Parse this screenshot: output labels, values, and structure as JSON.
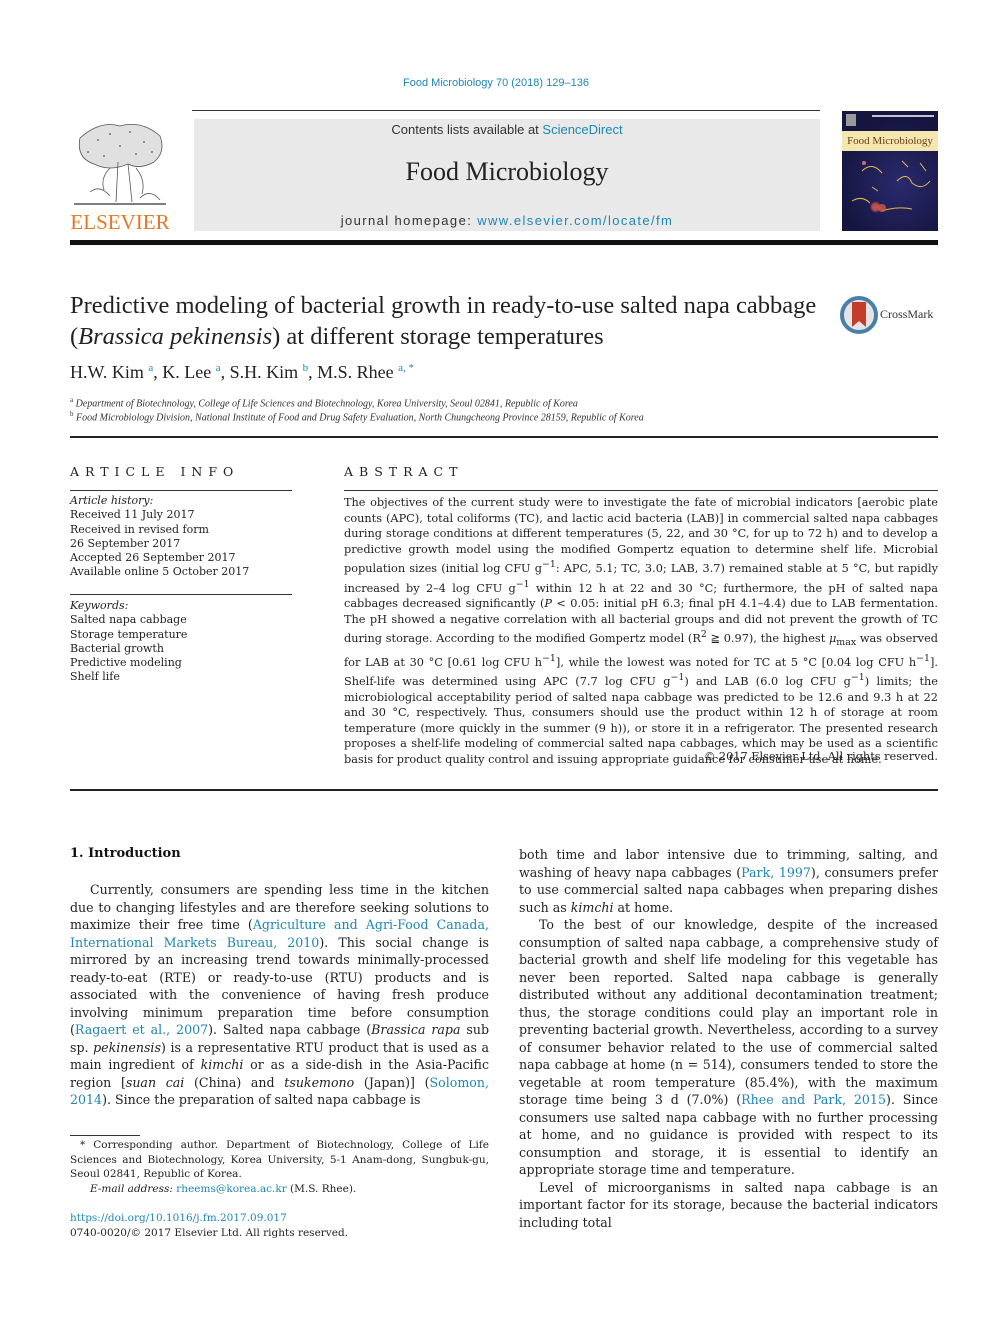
{
  "header": {
    "journal_reference": "Food Microbiology 70 (2018) 129–136",
    "contents_prefix": "Contents lists available at ",
    "contents_link": "ScienceDirect",
    "journal_title": "Food Microbiology",
    "homepage_prefix": "journal homepage: ",
    "homepage_link": "www.elsevier.com/locate/fm",
    "publisher_logo_text": "ELSEVIER",
    "cover_title": "Food Microbiology",
    "brand_color": "#e87722",
    "link_color": "#1e86b4"
  },
  "article": {
    "title_part1": "Predictive modeling of bacterial growth in ready-to-use salted napa cabbage (",
    "title_italic": "Brassica pekinensis",
    "title_part2": ") at different storage temperatures",
    "crossmark_label": "CrossMark",
    "authors": [
      {
        "name": "H.W. Kim",
        "sup": "a"
      },
      {
        "name": "K. Lee",
        "sup": "a"
      },
      {
        "name": "S.H. Kim",
        "sup": "b"
      },
      {
        "name": "M.S. Rhee",
        "sup": "a, *"
      }
    ],
    "affiliations": [
      {
        "mark": "a",
        "text": "Department of Biotechnology, College of Life Sciences and Biotechnology, Korea University, Seoul 02841, Republic of Korea"
      },
      {
        "mark": "b",
        "text": "Food Microbiology Division, National Institute of Food and Drug Safety Evaluation, North Chungcheong Province 28159, Republic of Korea"
      }
    ]
  },
  "article_info": {
    "heading": "ARTICLE INFO",
    "history_label": "Article history:",
    "history": [
      "Received 11 July 2017",
      "Received in revised form",
      "26 September 2017",
      "Accepted 26 September 2017",
      "Available online 5 October 2017"
    ],
    "keywords_label": "Keywords:",
    "keywords": [
      "Salted napa cabbage",
      "Storage temperature",
      "Bacterial growth",
      "Predictive modeling",
      "Shelf life"
    ]
  },
  "abstract": {
    "heading": "ABSTRACT",
    "segments": {
      "s1": "The objectives of the current study were to investigate the fate of microbial indicators [aerobic plate counts (APC), total coliforms (TC), and lactic acid bacteria (LAB)] in commercial salted napa cabbages during storage conditions at different temperatures (5, 22, and 30 °C, for up to 72 h) and to develop a predictive growth model using the modified Gompertz equation to determine shelf life. Microbial population sizes (initial log CFU g",
      "s2": ": APC, 5.1; TC, 3.0; LAB, 3.7) remained stable at 5 °C, but rapidly increased by 2–4 log CFU g",
      "s3": " within 12 h at 22 and 30 °C; furthermore, the pH of salted napa cabbages decreased significantly (",
      "s3_italic": "P",
      "s4": " < 0.05: initial pH 6.3; final pH 4.1–4.4) due to LAB fermentation. The pH showed a negative correlation with all bacterial groups and did not prevent the growth of TC during storage. According to the modified Gompertz model (R",
      "s4_sup": "2",
      "s5": " ≧ 0.97), the highest ",
      "mu": "μ",
      "mu_sub": "max",
      "s6": " was observed for LAB at 30 °C [0.61 log CFU h",
      "s7": "], while the lowest was noted for TC at 5 °C [0.04 log CFU h",
      "s8": "]. Shelf-life was determined using APC (7.7 log CFU g",
      "s9": ") and LAB (6.0 log CFU g",
      "s10": ") limits; the microbiological acceptability period of salted napa cabbage was predicted to be 12.6 and 9.3 h at 22 and 30 °C, respectively. Thus, consumers should use the product within 12 h of storage at room temperature (more quickly in the summer (9 h)), or store it in a refrigerator. The presented research proposes a shelf-life modeling of commercial salted napa cabbages, which may be used as a scientific basis for product quality control and issuing appropriate guidance for consumer use at home.",
      "neg1": "−1"
    },
    "copyright": "© 2017 Elsevier Ltd. All rights reserved."
  },
  "body": {
    "section_heading": "1.  Introduction",
    "left": {
      "p1_a": "Currently, consumers are spending less time in the kitchen due to changing lifestyles and are therefore seeking solutions to maximize their free time (",
      "p1_cite1": "Agriculture and Agri-Food Canada, International Markets Bureau, 2010",
      "p1_b": "). This social change is mirrored by an increasing trend towards minimally-processed ready-to-eat (RTE) or ready-to-use (RTU) products and is associated with the convenience of having fresh produce involving minimum preparation time before consumption (",
      "p1_cite2": "Ragaert et al., 2007",
      "p1_c": "). Salted napa cabbage (",
      "p1_i1": "Brassica rapa",
      "p1_d": " sub sp. ",
      "p1_i2": "pekinensis",
      "p1_e": ") is a representative RTU product that is used as a main ingredient of ",
      "p1_i3": "kimchi",
      "p1_f": " or as a side-dish in the Asia-Pacific region [",
      "p1_i4": "suan cai",
      "p1_g": " (China) and ",
      "p1_i5": "tsukemono",
      "p1_h": " (Japan)] (",
      "p1_cite3": "Solomon, 2014",
      "p1_j": "). Since the preparation of salted napa cabbage is"
    },
    "right": {
      "p1_a": "both time and labor intensive due to trimming, salting, and washing of heavy napa cabbages (",
      "p1_cite1": "Park, 1997",
      "p1_b": "), consumers prefer to use commercial salted napa cabbages when preparing dishes such as ",
      "p1_i1": "kimchi",
      "p1_c": " at home.",
      "p2_a": "To the best of our knowledge, despite of the increased consumption of salted napa cabbage, a comprehensive study of bacterial growth and shelf life modeling for this vegetable has never been reported. Salted napa cabbage is generally distributed without any additional decontamination treatment; thus, the storage conditions could play an important role in preventing bacterial growth. Nevertheless, according to a survey of consumer behavior related to the use of commercial salted napa cabbage at home (n = 514), consumers tended to store the vegetable at room temperature (85.4%), with the maximum storage time being 3 d (7.0%) (",
      "p2_cite1": "Rhee and Park, 2015",
      "p2_b": "). Since consumers use salted napa cabbage with no further processing at home, and no guidance is provided with respect to its consumption and storage, it is essential to identify an appropriate storage time and temperature.",
      "p3": "Level of microorganisms in salted napa cabbage is an important factor for its storage, because the bacterial indicators including total"
    }
  },
  "footnote": {
    "corresponding": "* Corresponding author. Department of Biotechnology, College of Life Sciences and Biotechnology, Korea University, 5-1 Anam-dong, Sungbuk-gu, Seoul 02841, Republic of Korea.",
    "email_label": "E-mail address: ",
    "email": "rheems@korea.ac.kr",
    "email_suffix": " (M.S. Rhee).",
    "doi": "https://doi.org/10.1016/j.fm.2017.09.017",
    "issn_line": "0740-0020/© 2017 Elsevier Ltd. All rights reserved."
  }
}
